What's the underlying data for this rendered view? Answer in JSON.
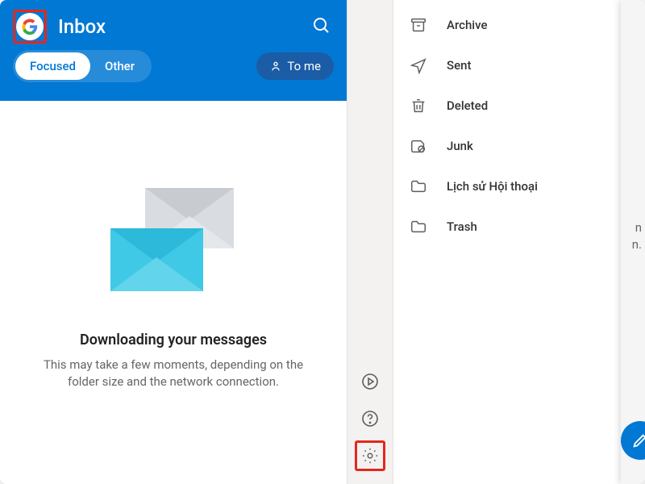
{
  "header": {
    "title": "Inbox",
    "tab_focused": "Focused",
    "tab_other": "Other",
    "to_me": "To me"
  },
  "empty": {
    "title": "Downloading your messages",
    "subtitle": "This may take a few moments, depending on the folder size and the network connection."
  },
  "folders": [
    {
      "icon": "archive",
      "label": "Archive"
    },
    {
      "icon": "sent",
      "label": "Sent"
    },
    {
      "icon": "deleted",
      "label": "Deleted"
    },
    {
      "icon": "junk",
      "label": "Junk"
    },
    {
      "icon": "folder",
      "label": "Lịch sử Hội thoại"
    },
    {
      "icon": "folder",
      "label": "Trash"
    }
  ],
  "edge": {
    "line1": "n",
    "line2": "n."
  }
}
